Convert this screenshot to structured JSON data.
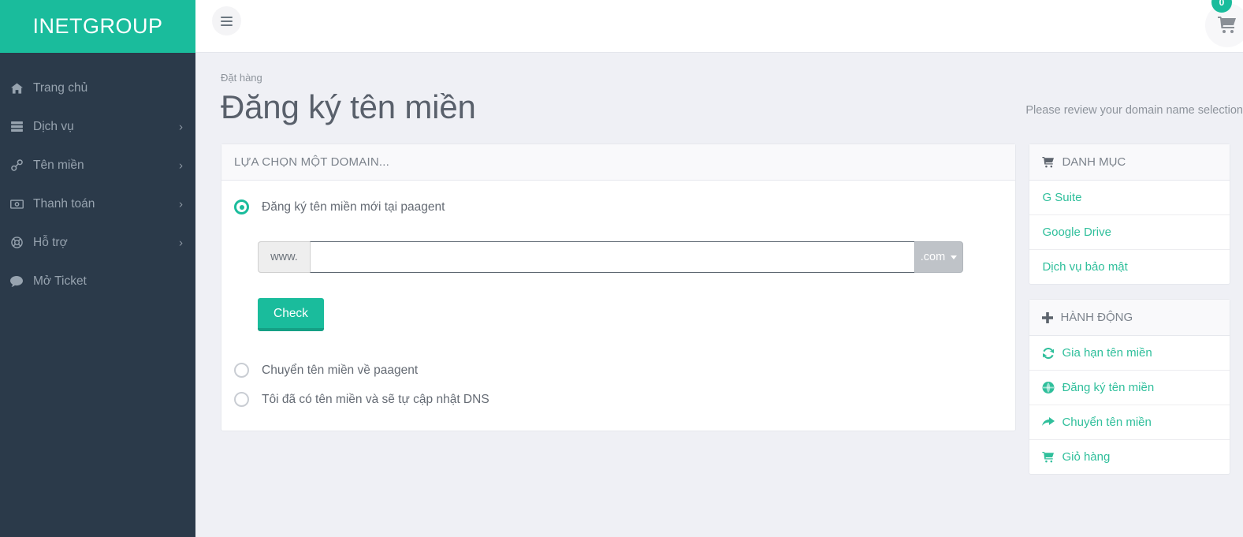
{
  "brand": {
    "name": "INETGROUP"
  },
  "topbar": {
    "menu_toggle_label": "Toggle navigation",
    "cart_count": "0"
  },
  "sidebar": {
    "items": [
      {
        "label": "Trang chủ",
        "icon": "home-icon",
        "has_caret": false
      },
      {
        "label": "Dịch vụ",
        "icon": "server-icon",
        "has_caret": true
      },
      {
        "label": "Tên miền",
        "icon": "link-icon",
        "has_caret": true
      },
      {
        "label": "Thanh toán",
        "icon": "money-icon",
        "has_caret": true
      },
      {
        "label": "Hỗ trợ",
        "icon": "lifebuoy-icon",
        "has_caret": true
      },
      {
        "label": "Mở Ticket",
        "icon": "comment-icon",
        "has_caret": false
      }
    ]
  },
  "page": {
    "breadcrumb": "Đặt hàng",
    "title": "Đăng ký tên miền",
    "note": "Please review your domain name selection"
  },
  "domain_panel": {
    "heading": "LỰA CHỌN MỘT DOMAIN...",
    "options": [
      {
        "label": "Đăng ký tên miền mới tại paagent",
        "selected": true
      },
      {
        "label": "Chuyển tên miền về paagent",
        "selected": false
      },
      {
        "label": "Tôi đã có tên miền và sẽ tự cập nhật DNS",
        "selected": false
      }
    ],
    "input": {
      "prefix": "www.",
      "value": "",
      "placeholder": "",
      "tld": ".com"
    },
    "check_button": "Check"
  },
  "side_panels": [
    {
      "title": "DANH MỤC",
      "icon": "cart-icon",
      "links": [
        {
          "label": "G Suite",
          "icon": ""
        },
        {
          "label": "Google Drive",
          "icon": ""
        },
        {
          "label": "Dịch vụ bảo mật",
          "icon": ""
        }
      ]
    },
    {
      "title": "HÀNH ĐỘNG",
      "icon": "plus-icon",
      "links": [
        {
          "label": "Gia hạn tên miền",
          "icon": "refresh-icon"
        },
        {
          "label": "Đăng ký tên miền",
          "icon": "globe-icon"
        },
        {
          "label": "Chuyển tên miền",
          "icon": "transfer-icon"
        },
        {
          "label": "Giỏ hàng",
          "icon": "cart-icon"
        }
      ]
    }
  ]
}
